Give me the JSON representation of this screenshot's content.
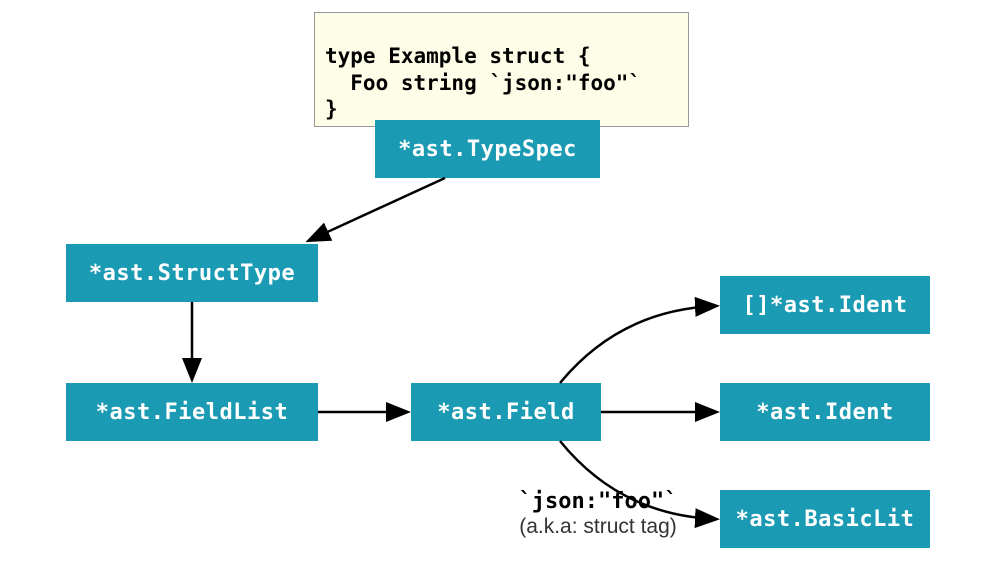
{
  "code": {
    "line1": "type Example struct {",
    "line2": "  Foo string `json:\"foo\"`",
    "line3": "}"
  },
  "nodes": {
    "typespec": "*ast.TypeSpec",
    "structtype": "*ast.StructType",
    "fieldlist": "*ast.FieldList",
    "field": "*ast.Field",
    "ident_slice": "[]*ast.Ident",
    "ident": "*ast.Ident",
    "basiclit": "*ast.BasicLit"
  },
  "annotation": {
    "tag": "`json:\"foo\"`",
    "sub": "(a.k.a: struct tag)"
  }
}
